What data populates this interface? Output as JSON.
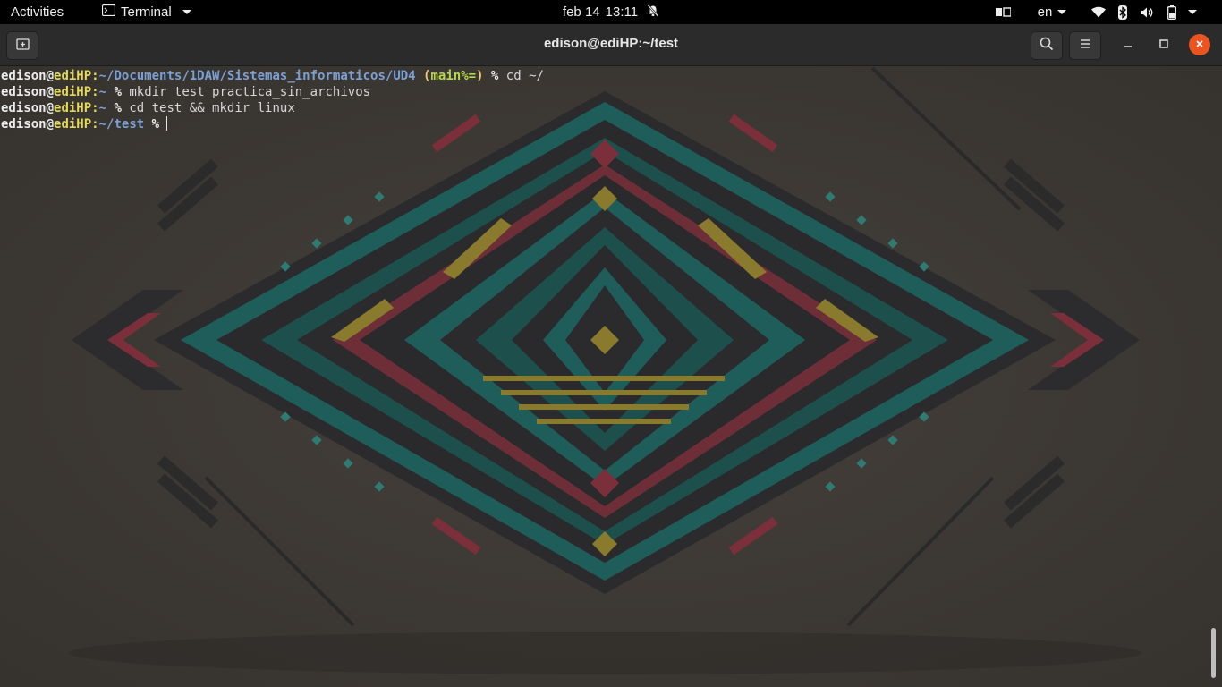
{
  "topbar": {
    "activities": "Activities",
    "app_name": "Terminal",
    "date": "feb 14",
    "time": "13:11",
    "language": "en",
    "icons": [
      "terminal-app-icon",
      "notifications-muted-icon",
      "keyboard-layout-icon",
      "wifi-icon",
      "bluetooth-icon",
      "volume-icon",
      "battery-icon"
    ]
  },
  "window": {
    "title": "edison@ediHP:~/test",
    "icons": [
      "new-tab-icon",
      "search-icon",
      "hamburger-menu-icon",
      "minimize-icon",
      "maximize-icon",
      "close-icon"
    ]
  },
  "terminal": {
    "lines": [
      {
        "user": "edison",
        "at": "@",
        "host": "ediHP",
        "sep": ":",
        "path": "~/Documents/1DAW/Sistemas_informaticos/UD4",
        "git_open": " (",
        "git_branch": "main",
        "git_status": "%=",
        "git_close": ")",
        "prompt": " % ",
        "command": "cd ~/"
      },
      {
        "user": "edison",
        "at": "@",
        "host": "ediHP",
        "sep": ":",
        "path": "~",
        "prompt": " % ",
        "command": "mkdir test practica_sin_archivos"
      },
      {
        "user": "edison",
        "at": "@",
        "host": "ediHP",
        "sep": ":",
        "path": "~",
        "prompt": " % ",
        "command": "cd test && mkdir linux"
      },
      {
        "user": "edison",
        "at": "@",
        "host": "ediHP",
        "sep": ":",
        "path": "~/test",
        "prompt": " % ",
        "command": ""
      }
    ]
  },
  "colors": {
    "accent_close": "#e95420",
    "hostname": "#e5d85b",
    "path": "#7aa0d6",
    "git_branch": "#b8d84b",
    "wallpaper_teal": "#1f5d5a",
    "wallpaper_red": "#7a2f3a",
    "wallpaper_olive": "#8a7a2e"
  }
}
